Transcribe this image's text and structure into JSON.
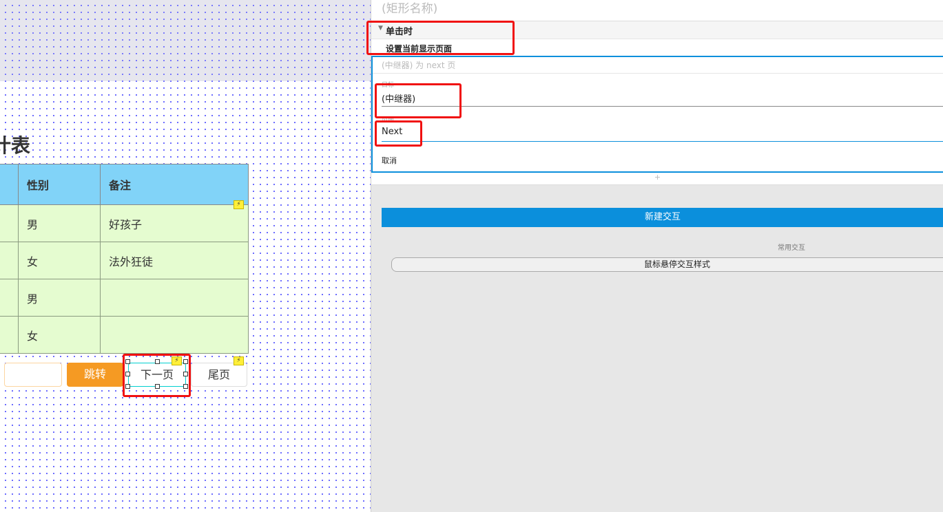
{
  "canvas": {
    "title": "统计表",
    "table": {
      "headers": [
        "",
        "性别",
        "备注"
      ],
      "rows": [
        [
          "",
          "男",
          "好孩子"
        ],
        [
          "",
          "女",
          "法外狂徒"
        ],
        [
          "",
          "男",
          ""
        ],
        [
          "",
          "女",
          ""
        ]
      ]
    },
    "buttons": {
      "jump": "跳转",
      "next": "下一页",
      "last": "尾页",
      "page_input": ""
    }
  },
  "panel": {
    "shape_name_placeholder": "(矩形名称)",
    "event": "单击时",
    "action": "设置当前显示页面",
    "summary": "(中继器) 为 next 页",
    "target_label": "目标",
    "target_value": "(中继器)",
    "page_label": "页面",
    "page_value": "Next",
    "cancel": "取消",
    "add_icon": "+",
    "new_interaction": "新建交互",
    "common_label": "常用交互",
    "hover_style": "鼠标悬停交互样式"
  },
  "colors": {
    "header": "#81d3f8",
    "row": "#e5fcd0",
    "jump": "#f59a23",
    "accent": "#0b8fdc",
    "highlight": "#f01010"
  }
}
